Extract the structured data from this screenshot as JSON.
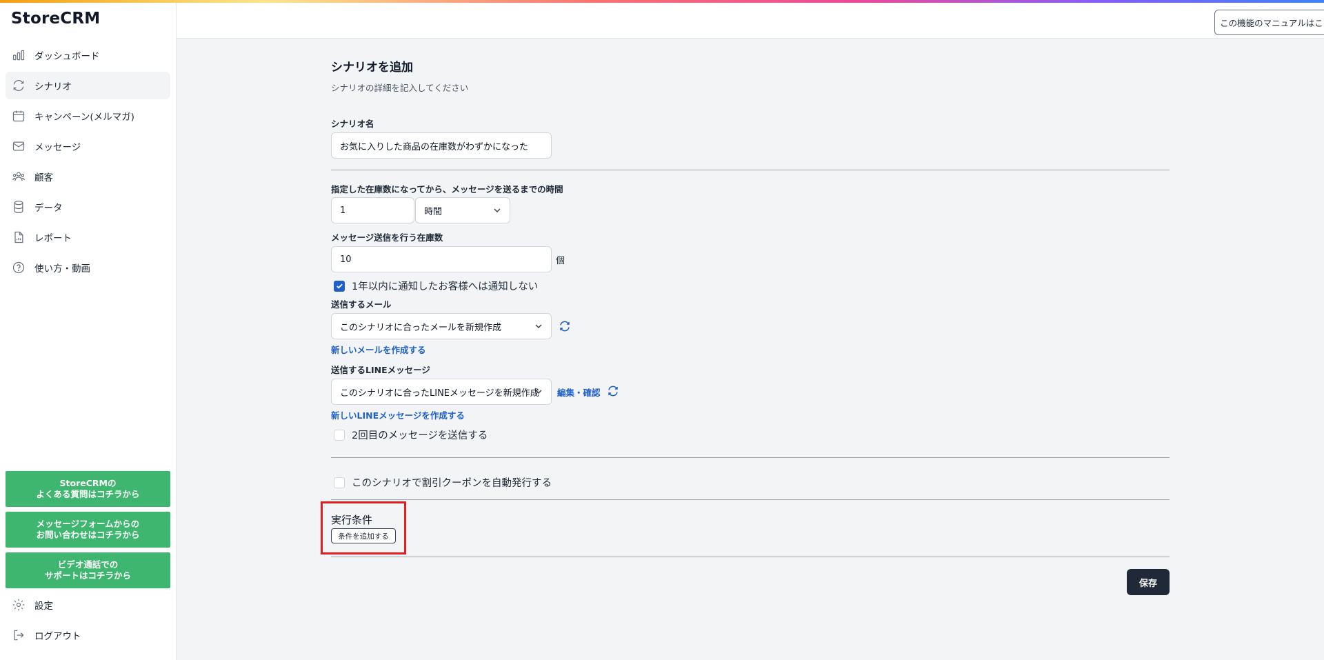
{
  "app": {
    "name": "StoreCRM"
  },
  "sidebar": {
    "items": [
      {
        "label": "ダッシュボード",
        "icon": "bar-chart-icon"
      },
      {
        "label": "シナリオ",
        "icon": "refresh-icon"
      },
      {
        "label": "キャンペーン(メルマガ)",
        "icon": "calendar-icon"
      },
      {
        "label": "メッセージ",
        "icon": "mail-icon"
      },
      {
        "label": "顧客",
        "icon": "users-icon"
      },
      {
        "label": "データ",
        "icon": "database-icon"
      },
      {
        "label": "レポート",
        "icon": "report-icon"
      },
      {
        "label": "使い方・動画",
        "icon": "help-icon"
      }
    ],
    "support": [
      {
        "label": "StoreCRMの\nよくある質問はコチラから"
      },
      {
        "label": "メッセージフォームからの\nお問い合わせはコチラから"
      },
      {
        "label": "ビデオ通話での\nサポートはコチラから"
      }
    ],
    "settings_label": "設定",
    "logout_label": "ログアウト"
  },
  "header": {
    "manual_label": "この機能のマニュアルはこちら"
  },
  "form": {
    "title": "シナリオを追加",
    "subtitle": "シナリオの詳細を記入してください",
    "name_label": "シナリオ名",
    "name_value": "お気に入りした商品の在庫数がわずかになった",
    "time_label": "指定した在庫数になってから、メッセージを送るまでの時間",
    "time_value": "1",
    "time_unit": "時間",
    "stock_label": "メッセージ送信を行う在庫数",
    "stock_value": "10",
    "stock_unit": "個",
    "no_repeat_label": "1年以内に通知したお客様へは通知しない",
    "mail_label": "送信するメール",
    "mail_value": "このシナリオに合ったメールを新規作成",
    "new_mail_link": "新しいメールを作成する",
    "line_label": "送信するLINEメッセージ",
    "line_value": "このシナリオに合ったLINEメッセージを新規作成",
    "line_edit_link": "編集・確認",
    "new_line_link": "新しいLINEメッセージを作成する",
    "second_message_label": "2回目のメッセージを送信する",
    "coupon_label": "このシナリオで割引クーポンを自動発行する",
    "conditions_title": "実行条件",
    "add_condition_label": "条件を追加する",
    "save_label": "保存"
  },
  "colors": {
    "accent": "#1e60c8",
    "support_green": "#3fb66f",
    "highlight": "#e11d1d",
    "save_button": "#1f2937"
  }
}
